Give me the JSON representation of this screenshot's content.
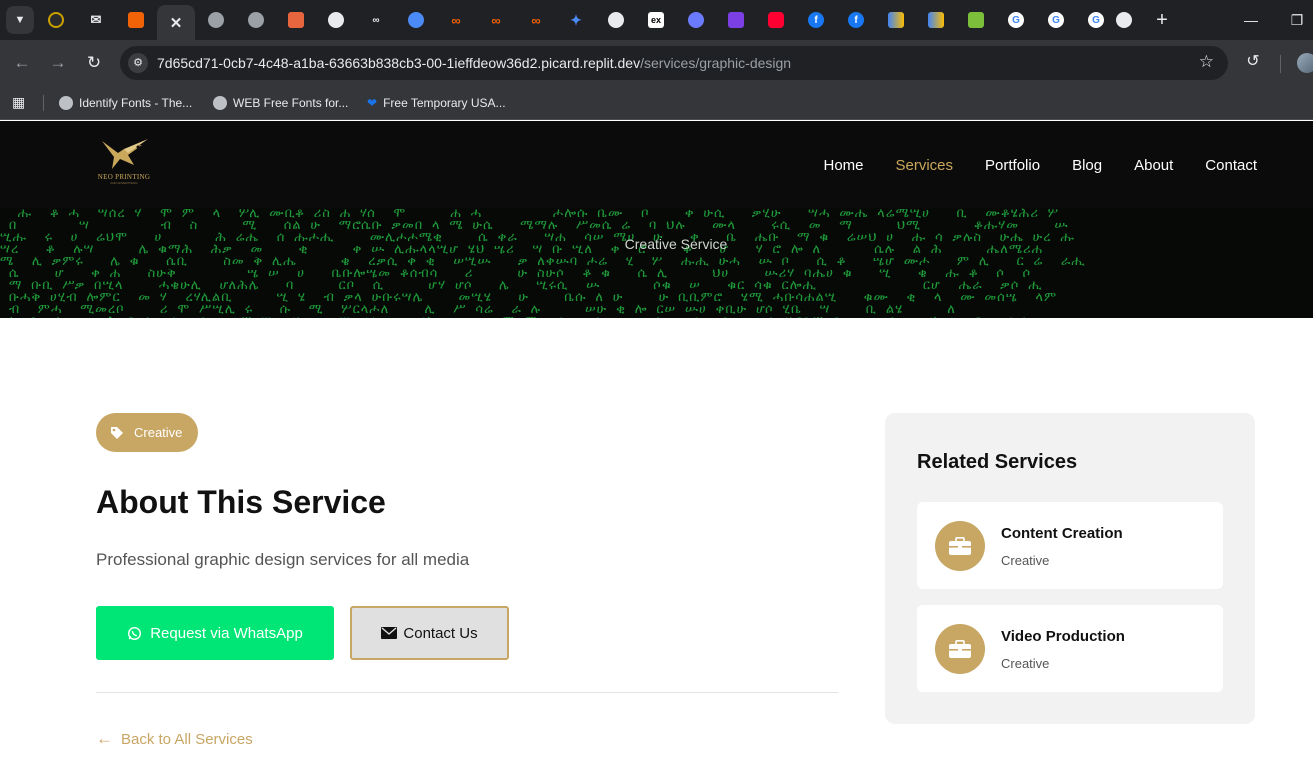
{
  "browser": {
    "url_host": "7d65cd71-0cb7-4c48-a1ba-63663b838cb3-00-1ieffdeow36d2.picard.replit.dev",
    "url_path": "/services/graphic-design",
    "tab_icons": [
      "chrome-ext-icon",
      "mail-icon",
      "replit-icon",
      "close-tab-icon",
      "globe-icon",
      "globe-icon",
      "office-icon",
      "github-icon",
      "link-icon",
      "globe-blue-icon",
      "replit-icon",
      "replit-icon",
      "replit-icon",
      "gemini-icon",
      "github-icon",
      "ex-icon",
      "mask-icon",
      "hashnode-icon",
      "youtube-icon",
      "facebook-icon",
      "facebook-icon",
      "analytics-icon",
      "analytics-icon",
      "green-app-icon",
      "google-icon",
      "google-icon",
      "google-icon",
      "key-icon"
    ],
    "bookmarks": [
      {
        "label": "Identify Fonts - The..."
      },
      {
        "label": "WEB Free Fonts for..."
      },
      {
        "label": "Free Temporary USA..."
      }
    ]
  },
  "site": {
    "logo_text": "NEO PRINTING",
    "logo_sub": "AND ADVERTISING",
    "nav": [
      {
        "label": "Home"
      },
      {
        "label": "Services"
      },
      {
        "label": "Portfolio"
      },
      {
        "label": "Blog"
      },
      {
        "label": "About"
      },
      {
        "label": "Contact"
      }
    ],
    "active_nav": "Services",
    "hero_title": "Creative Service",
    "brand_color": "#c8a664",
    "whatsapp_color": "#00e676"
  },
  "service": {
    "tag": "Creative",
    "heading": "About This Service",
    "description": "Professional graphic design services for all media",
    "whatsapp_label": "Request via WhatsApp",
    "contact_label": "Contact Us",
    "back_label": "Back to All Services"
  },
  "sidebar": {
    "title": "Related Services",
    "items": [
      {
        "name": "Content Creation",
        "category": "Creative"
      },
      {
        "name": "Video Production",
        "category": "Creative"
      }
    ]
  }
}
